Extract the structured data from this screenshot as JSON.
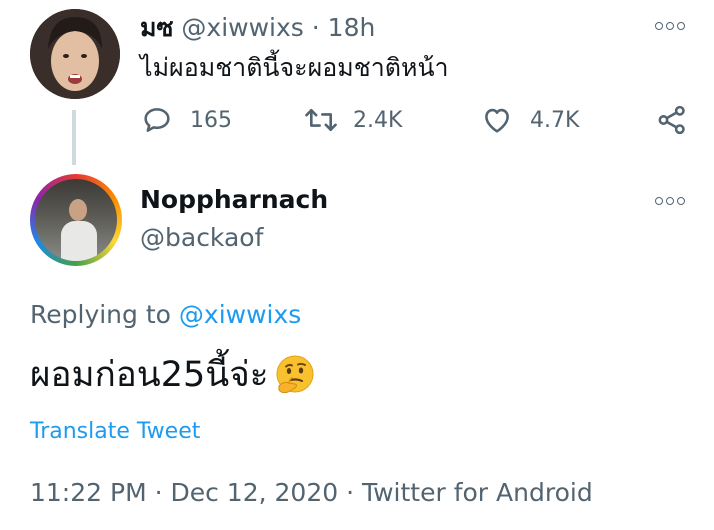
{
  "parent_tweet": {
    "display_name": "มซ",
    "handle": "@xiwwixs",
    "separator": "·",
    "time_ago": "18h",
    "text": "ไม่ผอมชาตินี้จะผอมชาติหน้า",
    "reply_count": "165",
    "retweet_count": "2.4K",
    "like_count": "4.7K",
    "icons": {
      "avatar": "avatar-photo",
      "more": "more-options-icon",
      "reply": "reply-icon",
      "retweet": "retweet-icon",
      "like": "heart-icon",
      "share": "share-icon"
    }
  },
  "reply_tweet": {
    "display_name": "Noppharnach",
    "handle": "@backaof",
    "replying_prefix": "Replying to",
    "replying_to": "@xiwwixs",
    "text": "ผอมก่อน25นี้จ่ะ",
    "emoji": "thinking-face",
    "translate_label": "Translate Tweet",
    "timestamp": "11:22 PM · Dec 12, 2020 · Twitter for Android"
  },
  "colors": {
    "text_primary": "#0f1419",
    "text_secondary": "#536471",
    "accent": "#1d9bf0",
    "thread_line": "#cfd9de"
  }
}
